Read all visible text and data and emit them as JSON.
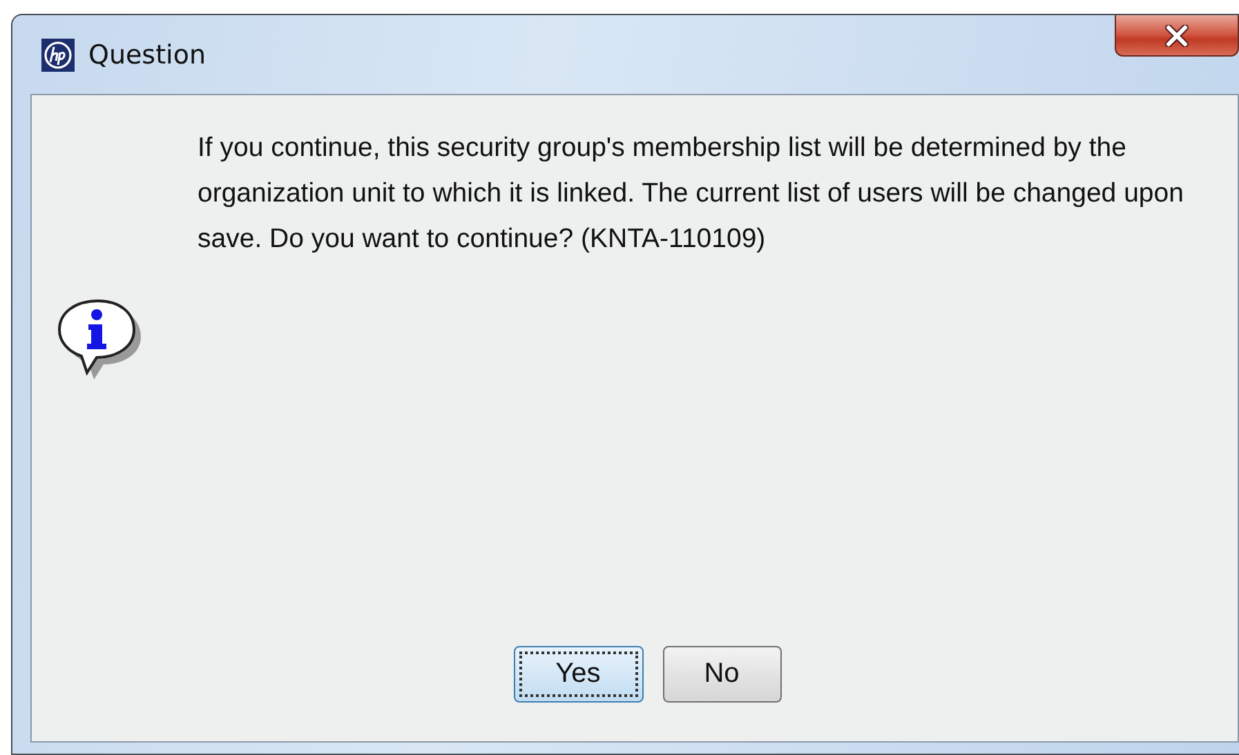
{
  "window": {
    "title": "Question"
  },
  "message": "If you continue, this security group's membership list will be determined by the organization unit to which it is linked. The current list of users will be changed upon save. Do you want to continue? (KNTA-110109)",
  "buttons": [
    {
      "label": "Yes",
      "selected": true
    },
    {
      "label": "No",
      "selected": false
    }
  ]
}
